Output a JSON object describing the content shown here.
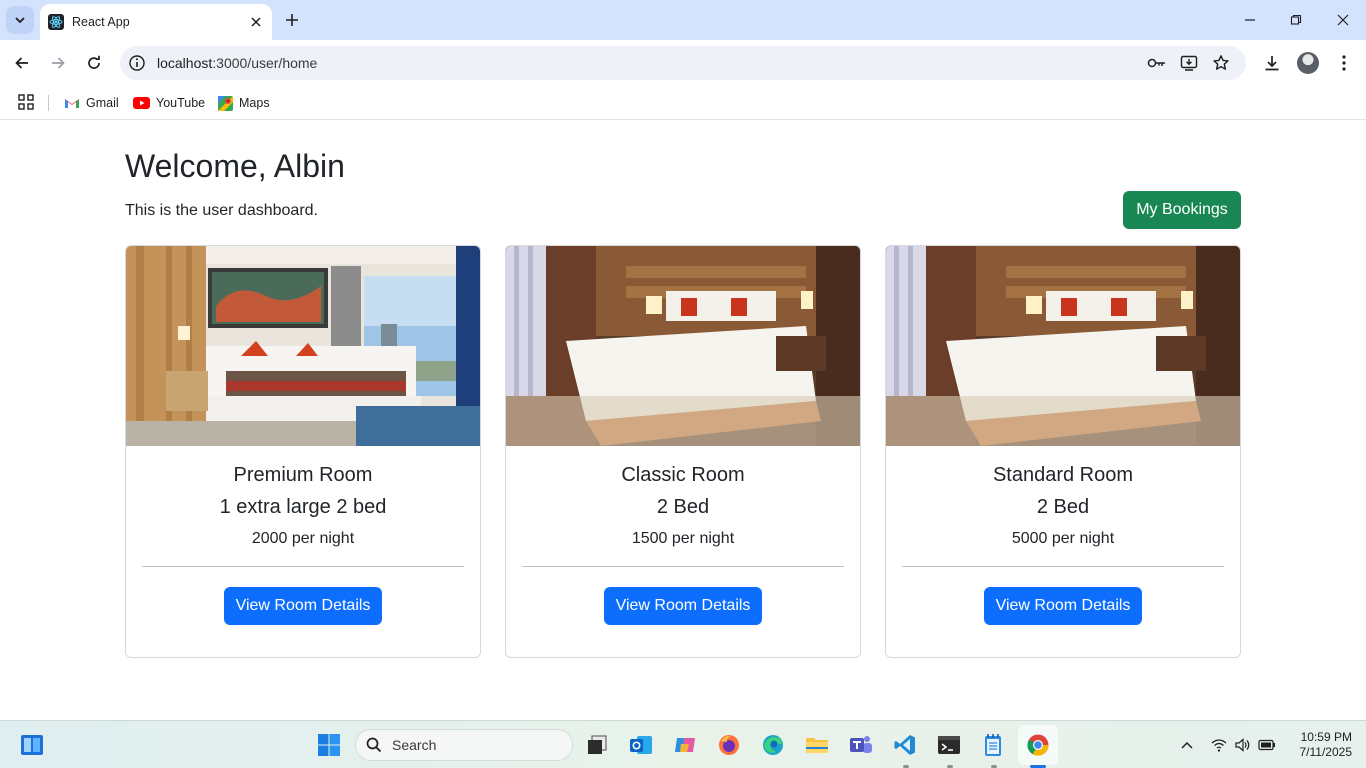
{
  "browser": {
    "tab_title": "React App",
    "url_host": "localhost",
    "url_path": ":3000/user/home",
    "bookmarks": [
      {
        "label": "Gmail",
        "icon": "gmail-icon"
      },
      {
        "label": "YouTube",
        "icon": "youtube-icon"
      },
      {
        "label": "Maps",
        "icon": "maps-icon"
      }
    ]
  },
  "page": {
    "heading": "Welcome, Albin",
    "subtitle": "This is the user dashboard.",
    "bookings_button": "My Bookings",
    "rooms": [
      {
        "name": "Premium Room",
        "beds": "1 extra large 2 bed",
        "price": "2000 per night",
        "button": "View Room Details"
      },
      {
        "name": "Classic Room",
        "beds": "2 Bed",
        "price": "1500 per night",
        "button": "View Room Details"
      },
      {
        "name": "Standard Room",
        "beds": "2 Bed",
        "price": "5000 per night",
        "button": "View Room Details"
      }
    ]
  },
  "taskbar": {
    "search_placeholder": "Search",
    "time": "10:59 PM",
    "date": "7/11/2025"
  },
  "colors": {
    "bookings_button": "#198754",
    "view_button": "#0d6efd",
    "tabstrip": "#d3e3fd"
  }
}
